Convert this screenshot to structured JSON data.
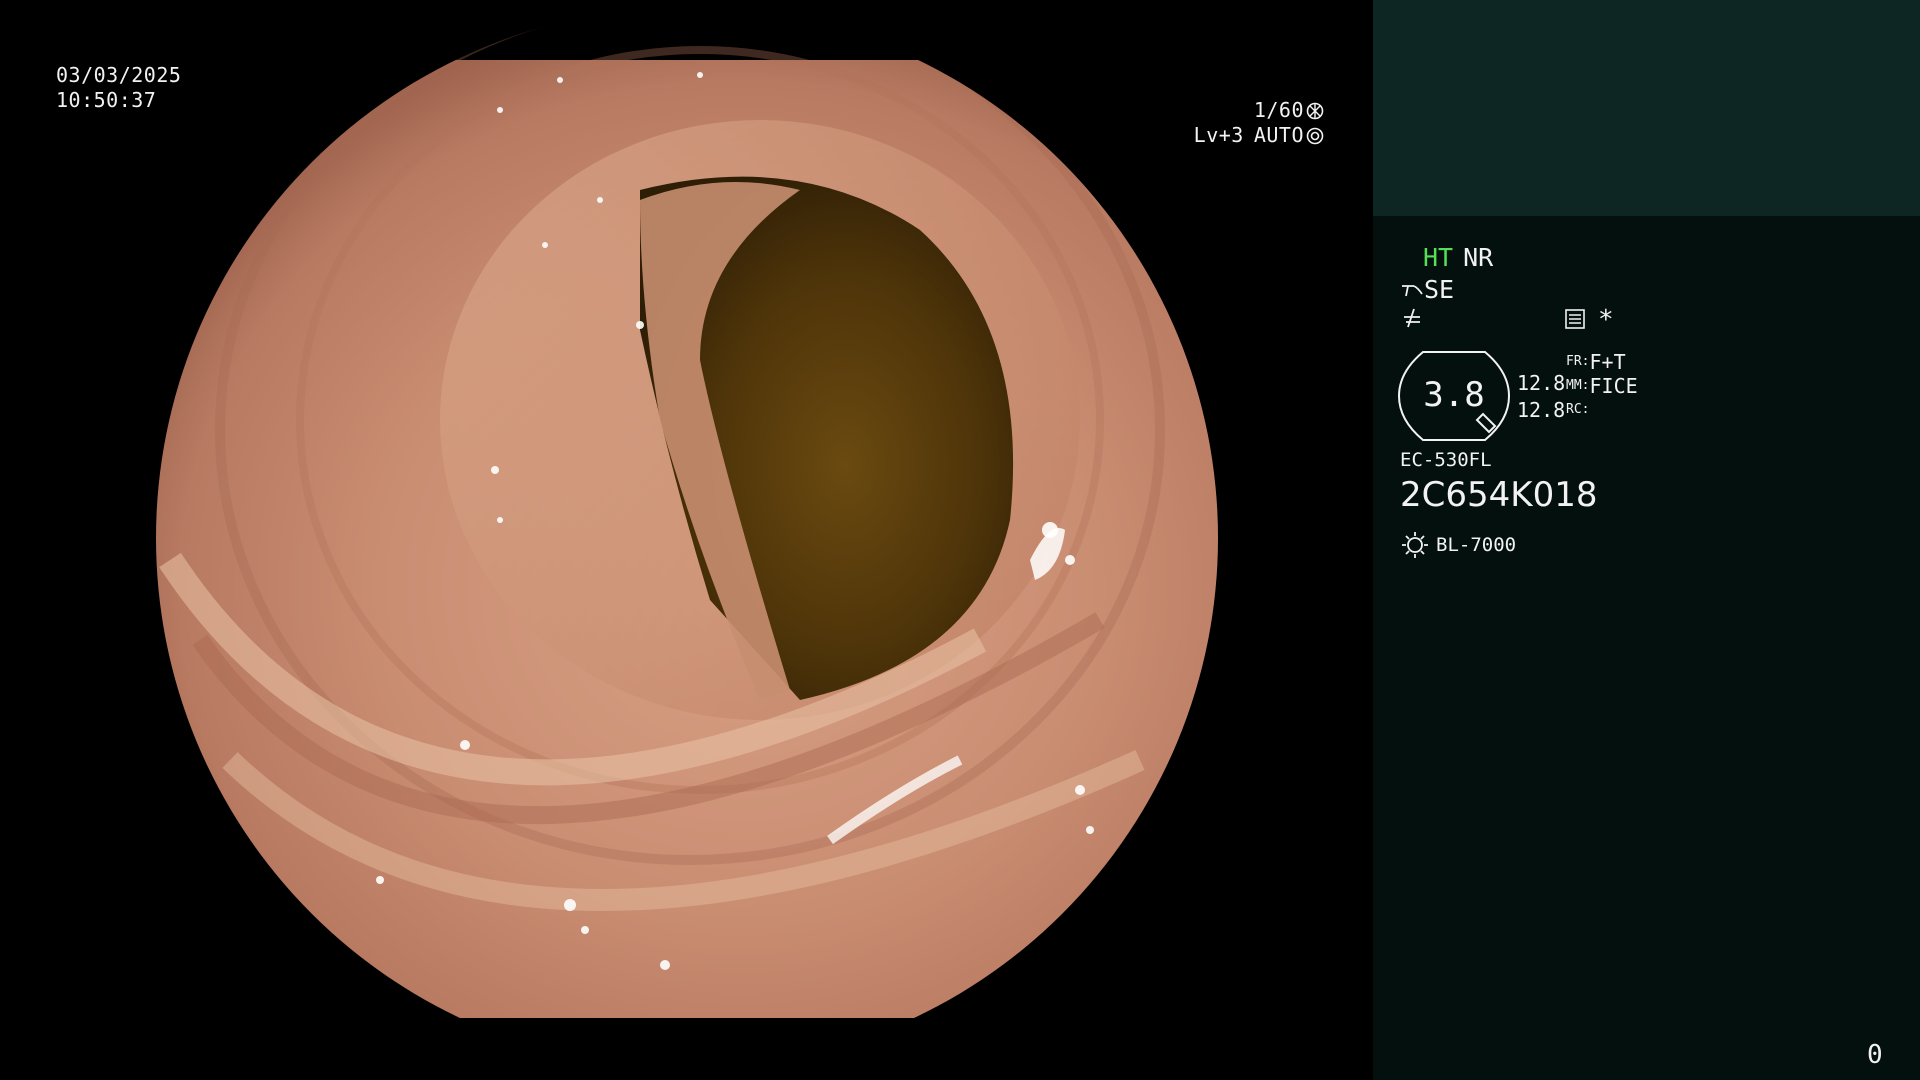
{
  "osd": {
    "date": "03/03/2025",
    "time": "10:50:37",
    "shutter": "1/60",
    "level": "Lv+3",
    "iris": "AUTO"
  },
  "panel": {
    "ht": "HT",
    "nr": "NR",
    "se": "SE",
    "asterisk": "*",
    "zoom_value": "3.8",
    "value_1": "12.8",
    "value_2": "12.8",
    "fr_label": "FR:",
    "fr_value": "F+T",
    "mm_label": "MM:",
    "mm_value": "FICE",
    "rc_label": "RC:",
    "scope_model": "EC-530FL",
    "serial": "2C654K018",
    "light_source": "BL-7000",
    "counter": "0"
  },
  "colors": {
    "panel_bg": "#04100e",
    "panel_top_bg": "#0d2523",
    "ht_green": "#55e055",
    "text": "#f2f2f2"
  },
  "icons": [
    "shutter-aperture-icon",
    "iris-icon",
    "scope-tip-icon",
    "structure-enhance-icon",
    "color-mode-icon",
    "memo-icon",
    "zoom-tip-icon",
    "light-bulb-icon"
  ]
}
